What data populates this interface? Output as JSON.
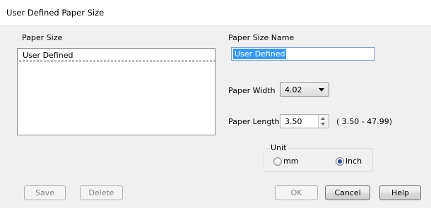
{
  "window": {
    "title": "User Defined Paper Size"
  },
  "paper_size": {
    "label": "Paper Size",
    "items": [
      "User Defined"
    ]
  },
  "paper_size_name": {
    "label": "Paper Size Name",
    "value": "User Defined"
  },
  "paper_width": {
    "label": "Paper Width",
    "value": "4.02"
  },
  "paper_length": {
    "label": "Paper Length",
    "value": "3.50",
    "range": "( 3.50 - 47.99)"
  },
  "unit": {
    "label": "Unit",
    "options": [
      {
        "label": "mm",
        "selected": false
      },
      {
        "label": "inch",
        "selected": true
      }
    ]
  },
  "buttons": {
    "save": "Save",
    "delete": "Delete",
    "ok": "OK",
    "cancel": "Cancel",
    "help": "Help"
  }
}
